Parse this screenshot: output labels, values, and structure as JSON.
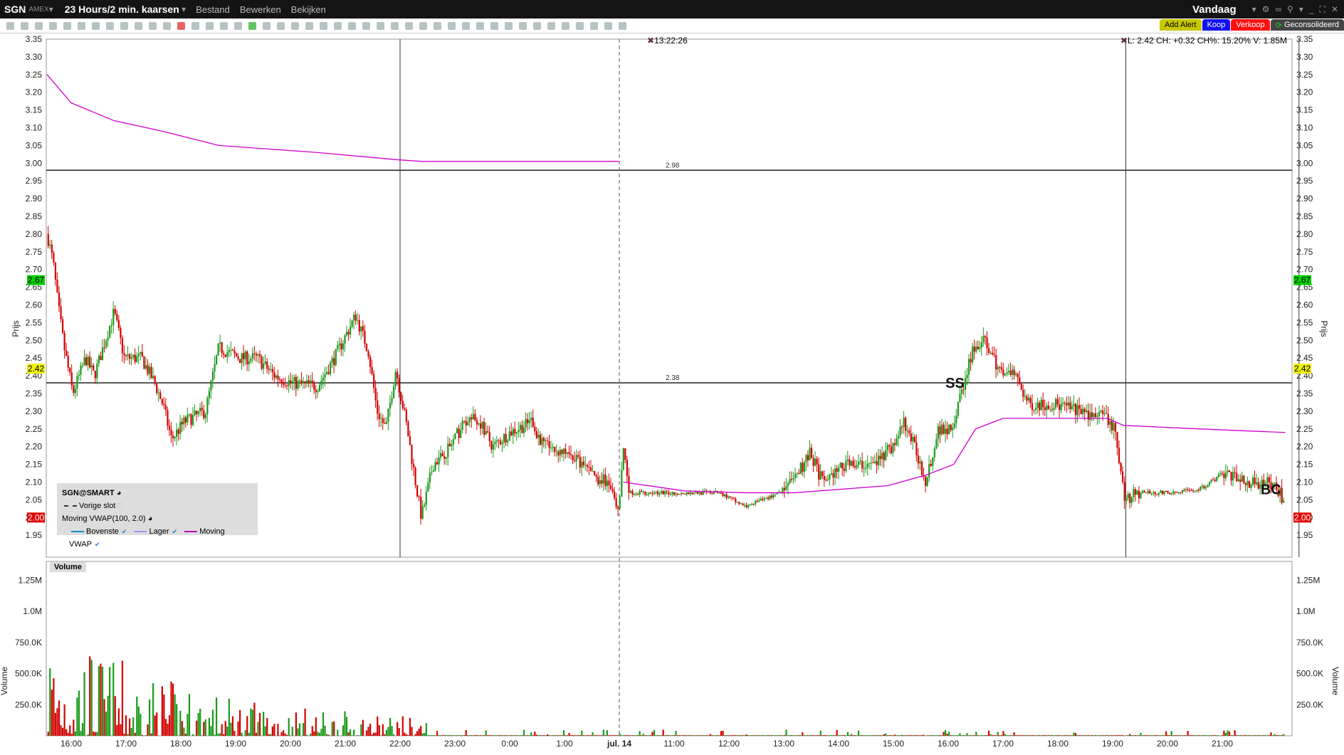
{
  "titlebar": {
    "symbol": "SGN",
    "exchange": "AMEX",
    "period": "23 Hours/2 min. kaarsen",
    "menu": [
      "Bestand",
      "Bewerken",
      "Bekijken"
    ],
    "range": "Vandaag"
  },
  "buttons": {
    "alert": "Add Alert",
    "buy": "Koop",
    "sell": "Verkoop",
    "consolidated": "Geconsolideerd"
  },
  "colors": {
    "up": "#1a9a1a",
    "down": "#d40000",
    "vwap": "#d000d0",
    "alert": "#c8c800",
    "buy": "#1010f0",
    "sell": "#ff1010"
  },
  "crosshair_time": "13:22:26",
  "quote": "L: 2.42 CH: +0.32 CH%: 15.20% V: 1.85M",
  "price_axis": {
    "title": "Prijs",
    "min": 1.95,
    "max": 3.35,
    "step": 0.05,
    "ticks": [
      "3.35",
      "3.30",
      "3.25",
      "3.20",
      "3.15",
      "3.10",
      "3.05",
      "3.00",
      "2.95",
      "2.90",
      "2.85",
      "2.80",
      "2.75",
      "2.70",
      "2.65",
      "2.60",
      "2.55",
      "2.50",
      "2.45",
      "2.40",
      "2.35",
      "2.30",
      "2.25",
      "2.20",
      "2.15",
      "2.10",
      "2.05",
      "2.00",
      "1.95"
    ]
  },
  "badges": [
    {
      "text": "2.67",
      "value": 2.67,
      "color": "#00d000"
    },
    {
      "text": "2.42",
      "value": 2.42,
      "color": "#f0f000"
    },
    {
      "text": "2.00",
      "value": 2.0,
      "color": "#e00000"
    }
  ],
  "hlines": [
    {
      "label": "2.98",
      "value": 2.98
    },
    {
      "label": "2.38",
      "value": 2.38
    }
  ],
  "vlines": [
    6.0,
    19.24,
    22.4
  ],
  "session_break": 10.0,
  "annotations": [
    {
      "text": "SS",
      "t": 15.95,
      "price": 2.38
    },
    {
      "text": "BC",
      "t": 21.7,
      "price": 2.08
    }
  ],
  "volume_axis": {
    "title": "Volume",
    "label": "Volume",
    "max": 1.45,
    "ticks": [
      {
        "text": "1.25M",
        "value": 1.25
      },
      {
        "text": "1.0M",
        "value": 1.0
      },
      {
        "text": "750.0K",
        "value": 0.75
      },
      {
        "text": "500.0K",
        "value": 0.5
      },
      {
        "text": "250.0K",
        "value": 0.25
      }
    ]
  },
  "time_axis": [
    "16:00",
    "17:00",
    "18:00",
    "19:00",
    "20:00",
    "21:00",
    "22:00",
    "23:00",
    "0:00",
    "1:00",
    "jul. 14",
    "11:00",
    "12:00",
    "13:00",
    "14:00",
    "15:00",
    "16:00",
    "17:00",
    "18:00",
    "19:00",
    "20:00",
    "21:00"
  ],
  "legend": {
    "title": "SGN@SMART",
    "prev_close": "Vorige slot",
    "study": "Moving VWAP(100, 2.0)",
    "items": [
      {
        "label": "Bovenste",
        "color": "#1a8ad4"
      },
      {
        "label": "Lager",
        "color": "#a890f0"
      },
      {
        "label": "Moving VWAP",
        "color": "#c000c0"
      }
    ],
    "volume": "Volume"
  },
  "price_path": [
    [
      -0.44,
      2.8
    ],
    [
      -0.33,
      2.72
    ],
    [
      -0.24,
      2.6
    ],
    [
      -0.13,
      2.48
    ],
    [
      0.03,
      2.35
    ],
    [
      0.26,
      2.45
    ],
    [
      0.42,
      2.4
    ],
    [
      0.78,
      2.58
    ],
    [
      0.97,
      2.45
    ],
    [
      1.28,
      2.45
    ],
    [
      1.52,
      2.38
    ],
    [
      1.67,
      2.32
    ],
    [
      1.83,
      2.22
    ],
    [
      2.06,
      2.27
    ],
    [
      2.45,
      2.3
    ],
    [
      2.69,
      2.48
    ],
    [
      3.08,
      2.45
    ],
    [
      3.39,
      2.45
    ],
    [
      3.71,
      2.4
    ],
    [
      4.02,
      2.38
    ],
    [
      4.49,
      2.37
    ],
    [
      4.8,
      2.45
    ],
    [
      5.19,
      2.57
    ],
    [
      5.42,
      2.47
    ],
    [
      5.58,
      2.3
    ],
    [
      5.74,
      2.25
    ],
    [
      5.92,
      2.42
    ],
    [
      6.13,
      2.25
    ],
    [
      6.28,
      2.1
    ],
    [
      6.39,
      2.0
    ],
    [
      6.6,
      2.15
    ],
    [
      6.91,
      2.2
    ],
    [
      7.22,
      2.28
    ],
    [
      7.46,
      2.27
    ],
    [
      7.69,
      2.2
    ],
    [
      8.0,
      2.24
    ],
    [
      8.39,
      2.27
    ],
    [
      8.63,
      2.2
    ],
    [
      9.1,
      2.18
    ],
    [
      9.49,
      2.12
    ],
    [
      9.8,
      2.1
    ],
    [
      9.99,
      2.0
    ],
    [
      10.07,
      2.2
    ],
    [
      10.19,
      2.07
    ],
    [
      10.58,
      2.07
    ],
    [
      11.21,
      2.07
    ],
    [
      11.84,
      2.07
    ],
    [
      12.3,
      2.03
    ],
    [
      12.77,
      2.06
    ],
    [
      13.09,
      2.09
    ],
    [
      13.48,
      2.18
    ],
    [
      13.71,
      2.1
    ],
    [
      14.1,
      2.15
    ],
    [
      14.65,
      2.15
    ],
    [
      14.96,
      2.2
    ],
    [
      15.2,
      2.27
    ],
    [
      15.43,
      2.18
    ],
    [
      15.59,
      2.1
    ],
    [
      15.82,
      2.25
    ],
    [
      16.06,
      2.25
    ],
    [
      16.29,
      2.38
    ],
    [
      16.45,
      2.48
    ],
    [
      16.68,
      2.5
    ],
    [
      16.92,
      2.42
    ],
    [
      17.23,
      2.4
    ],
    [
      17.46,
      2.32
    ],
    [
      17.93,
      2.32
    ],
    [
      18.4,
      2.3
    ],
    [
      18.87,
      2.28
    ],
    [
      19.03,
      2.25
    ],
    [
      19.22,
      2.05
    ],
    [
      19.5,
      2.07
    ],
    [
      19.97,
      2.07
    ],
    [
      20.59,
      2.08
    ],
    [
      21.06,
      2.13
    ],
    [
      21.37,
      2.1
    ],
    [
      21.84,
      2.1
    ],
    [
      22.15,
      2.05
    ]
  ],
  "vwap_path": [
    [
      [
        -0.44,
        3.25
      ],
      [
        0.0,
        3.17
      ],
      [
        0.78,
        3.12
      ],
      [
        1.67,
        3.09
      ],
      [
        2.69,
        3.05
      ],
      [
        4.5,
        3.03
      ],
      [
        5.92,
        3.01
      ],
      [
        6.4,
        3.005
      ],
      [
        9.99,
        3.005
      ]
    ],
    [
      [
        10.07,
        2.1
      ],
      [
        11.2,
        2.075
      ],
      [
        12.3,
        2.07
      ],
      [
        13.2,
        2.07
      ],
      [
        14.9,
        2.09
      ],
      [
        15.6,
        2.12
      ],
      [
        16.1,
        2.15
      ],
      [
        16.5,
        2.25
      ],
      [
        17.0,
        2.28
      ],
      [
        18.9,
        2.28
      ],
      [
        19.2,
        2.26
      ],
      [
        20.6,
        2.25
      ],
      [
        22.15,
        2.24
      ]
    ]
  ]
}
